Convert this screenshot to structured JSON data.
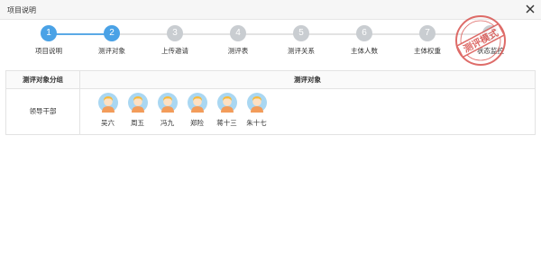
{
  "window": {
    "title": "项目说明"
  },
  "steps": [
    {
      "num": "1",
      "label": "项目说明",
      "active": true
    },
    {
      "num": "2",
      "label": "测评对象",
      "active": true
    },
    {
      "num": "3",
      "label": "上传邀请",
      "active": false
    },
    {
      "num": "4",
      "label": "测评表",
      "active": false
    },
    {
      "num": "5",
      "label": "测评关系",
      "active": false
    },
    {
      "num": "6",
      "label": "主体人数",
      "active": false
    },
    {
      "num": "7",
      "label": "主体权重",
      "active": false
    },
    {
      "num": "8",
      "label": "状态监控",
      "active": false
    }
  ],
  "stamp": {
    "text": "测评模式"
  },
  "table": {
    "headers": {
      "group": "测评对象分组",
      "target": "测评对象"
    },
    "rows": [
      {
        "group": "领导干部",
        "people": [
          "吴六",
          "周五",
          "冯九",
          "郑险",
          "蒋十三",
          "朱十七"
        ]
      }
    ]
  },
  "colors": {
    "active_step": "#4aa2e6",
    "inactive_step": "#c9cdd1",
    "stamp": "#d9534f",
    "avatar_bg": "#a9d7f2"
  }
}
